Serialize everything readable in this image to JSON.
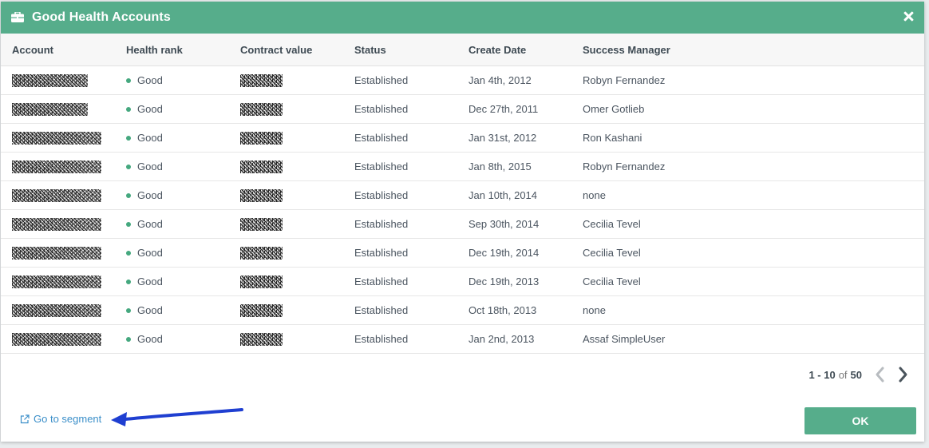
{
  "dialog": {
    "title": "Good Health Accounts"
  },
  "columns": [
    "Account",
    "Health rank",
    "Contract value",
    "Status",
    "Create Date",
    "Success Manager"
  ],
  "rows": [
    {
      "health": "Good",
      "status": "Established",
      "date": "Jan 4th, 2012",
      "manager": "Robyn Fernandez"
    },
    {
      "health": "Good",
      "status": "Established",
      "date": "Dec 27th, 2011",
      "manager": "Omer Gotlieb"
    },
    {
      "health": "Good",
      "status": "Established",
      "date": "Jan 31st, 2012",
      "manager": "Ron Kashani"
    },
    {
      "health": "Good",
      "status": "Established",
      "date": "Jan 8th, 2015",
      "manager": "Robyn Fernandez"
    },
    {
      "health": "Good",
      "status": "Established",
      "date": "Jan 10th, 2014",
      "manager": "none"
    },
    {
      "health": "Good",
      "status": "Established",
      "date": "Sep 30th, 2014",
      "manager": "Cecilia Tevel"
    },
    {
      "health": "Good",
      "status": "Established",
      "date": "Dec 19th, 2014",
      "manager": "Cecilia Tevel"
    },
    {
      "health": "Good",
      "status": "Established",
      "date": "Dec 19th, 2013",
      "manager": "Cecilia Tevel"
    },
    {
      "health": "Good",
      "status": "Established",
      "date": "Oct 18th, 2013",
      "manager": "none"
    },
    {
      "health": "Good",
      "status": "Established",
      "date": "Jan 2nd, 2013",
      "manager": "Assaf SimpleUser"
    }
  ],
  "pagination": {
    "range": "1 - 10",
    "of_label": "of",
    "total": "50"
  },
  "footer": {
    "segment_link": "Go to segment",
    "ok_label": "OK"
  },
  "icons": {
    "header": "briefcase-icon",
    "close": "close-icon",
    "prev": "chevron-left-icon",
    "next": "chevron-right-icon",
    "link": "external-link-icon"
  },
  "colors": {
    "accent": "#56ad8b",
    "good_dot": "#45a87f",
    "link": "#3b8fc9",
    "annotation_arrow": "#1f3fd1"
  }
}
